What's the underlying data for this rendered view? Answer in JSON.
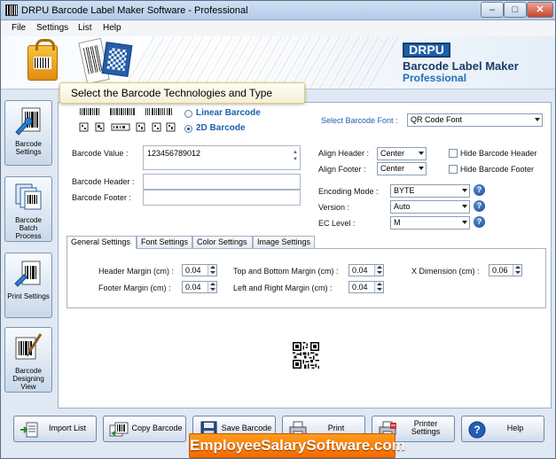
{
  "window": {
    "title": "DRPU Barcode Label Maker Software - Professional",
    "min_label": "–",
    "max_label": "□",
    "close_label": "✕"
  },
  "menu": [
    "File",
    "Settings",
    "List",
    "Help"
  ],
  "banner": {
    "logo": "DRPU",
    "product_line1": "Barcode Label Maker",
    "product_line2": "Professional"
  },
  "tooltip": "Select the Barcode Technologies and Type",
  "sidebar": [
    {
      "label": "Barcode Settings",
      "icon": "barcode-wrench-icon"
    },
    {
      "label": "Barcode Batch Process",
      "icon": "batch-documents-icon"
    },
    {
      "label": "Print Settings",
      "icon": "print-settings-icon"
    },
    {
      "label": "Barcode Designing View",
      "icon": "design-brush-icon"
    }
  ],
  "technology": {
    "linear_label": "Linear Barcode",
    "twod_label": "2D Barcode",
    "selected": "2D Barcode"
  },
  "font": {
    "label": "Select Barcode Font :",
    "value": "QR Code Font"
  },
  "fields": {
    "value_label": "Barcode Value :",
    "value": "123456789012",
    "header_label": "Barcode Header :",
    "header_value": "",
    "footer_label": "Barcode Footer :",
    "footer_value": ""
  },
  "align": {
    "header_label": "Align Header :",
    "header_value": "Center",
    "footer_label": "Align Footer :",
    "footer_value": "Center",
    "hide_header_label": "Hide Barcode Header",
    "hide_footer_label": "Hide Barcode Footer"
  },
  "encoding": {
    "mode_label": "Encoding Mode :",
    "mode_value": "BYTE",
    "version_label": "Version :",
    "version_value": "Auto",
    "ec_label": "EC Level :",
    "ec_value": "M",
    "help_glyph": "?"
  },
  "tabs": [
    "General Settings",
    "Font Settings",
    "Color Settings",
    "Image Settings"
  ],
  "active_tab": "General Settings",
  "general": {
    "header_margin_label": "Header Margin (cm) :",
    "header_margin": "0.04",
    "footer_margin_label": "Footer Margin (cm) :",
    "footer_margin": "0.04",
    "tb_margin_label": "Top and Bottom Margin (cm) :",
    "tb_margin": "0.04",
    "lr_margin_label": "Left and Right Margin (cm) :",
    "lr_margin": "0.04",
    "xdim_label": "X Dimension (cm) :",
    "xdim": "0.06"
  },
  "bottom_buttons": [
    {
      "label": "Import List",
      "icon": "import-list-icon"
    },
    {
      "label": "Copy Barcode",
      "icon": "copy-barcode-icon"
    },
    {
      "label": "Save Barcode",
      "icon": "floppy-disk-icon"
    },
    {
      "label": "Print",
      "icon": "printer-icon"
    },
    {
      "label": "Printer Settings",
      "icon": "printer-settings-icon"
    },
    {
      "label": "Help",
      "icon": "help-icon"
    }
  ],
  "watermark": "EmployeeSalarySoftware.com",
  "colors": {
    "accent": "#1d5fb0",
    "watermark_bg": "#f26b00",
    "panel_bg": "#dfe8f3"
  }
}
